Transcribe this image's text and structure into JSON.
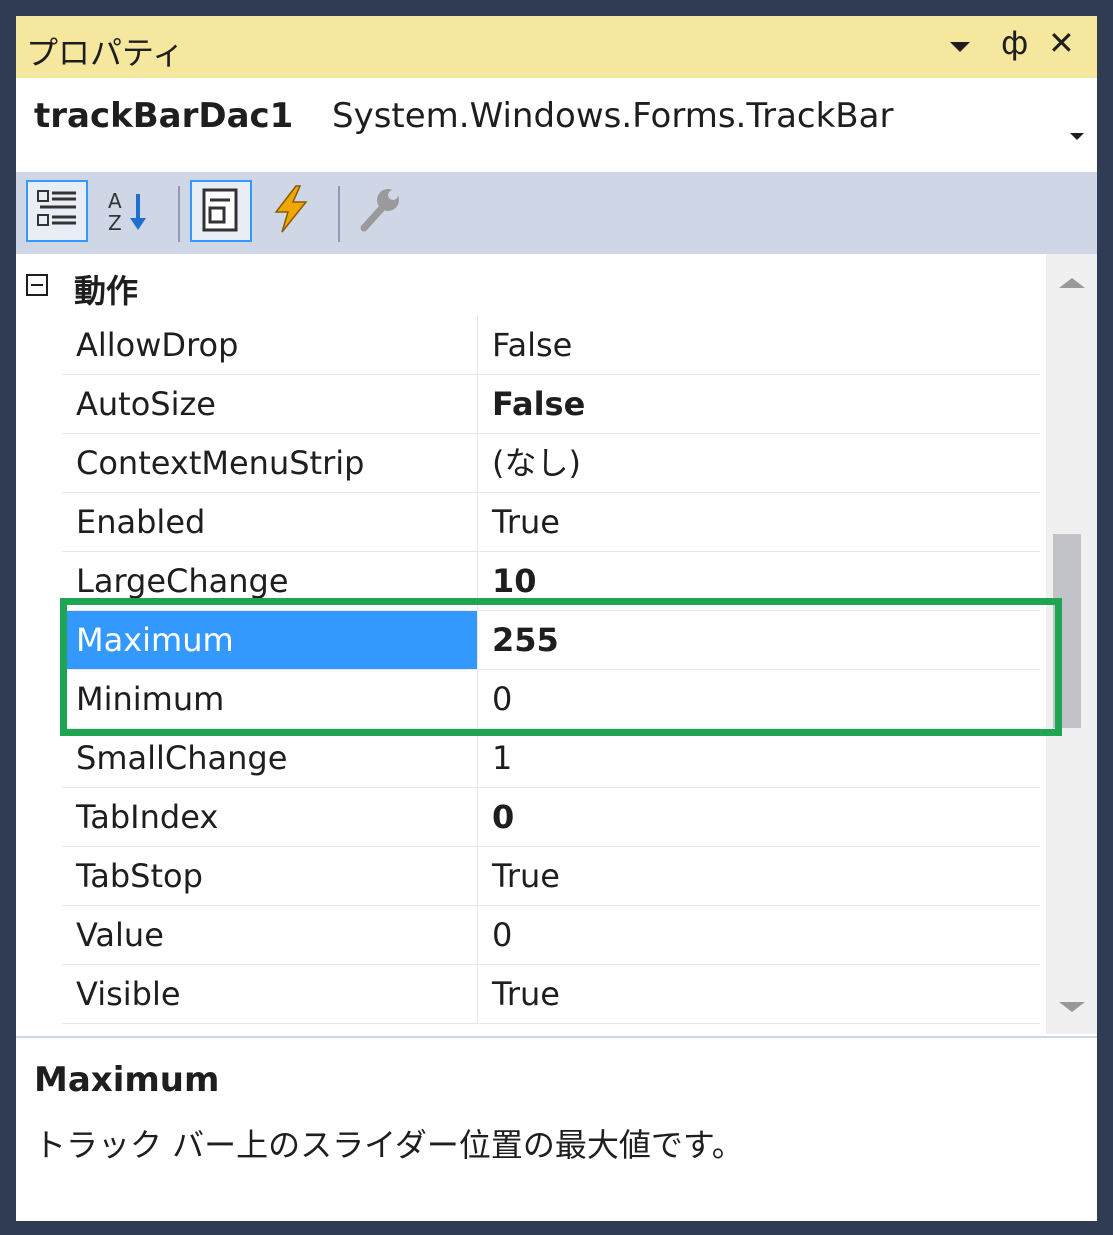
{
  "titlebar": {
    "title": "プロパティ",
    "pin_glyph": "ф",
    "close_glyph": "✕"
  },
  "object_selector": {
    "name": "trackBarDac1",
    "type": "System.Windows.Forms.TrackBar"
  },
  "toolbar": {
    "buttons": [
      {
        "icon": "categorized-icon",
        "active": true
      },
      {
        "icon": "alphabetical-sort-icon",
        "active": false
      },
      {
        "icon": "properties-page-icon",
        "active": true
      },
      {
        "icon": "events-lightning-icon",
        "active": false
      },
      {
        "icon": "property-pages-wrench-icon",
        "active": false
      }
    ]
  },
  "grid": {
    "category": "動作",
    "properties": [
      {
        "name": "AllowDrop",
        "value": "False"
      },
      {
        "name": "AutoSize",
        "value": "False"
      },
      {
        "name": "ContextMenuStrip",
        "value": "(なし)"
      },
      {
        "name": "Enabled",
        "value": "True"
      },
      {
        "name": "LargeChange",
        "value": "10"
      },
      {
        "name": "Maximum",
        "value": "255"
      },
      {
        "name": "Minimum",
        "value": "0"
      },
      {
        "name": "SmallChange",
        "value": "1"
      },
      {
        "name": "TabIndex",
        "value": "0"
      },
      {
        "name": "TabStop",
        "value": "True"
      },
      {
        "name": "Value",
        "value": "0"
      },
      {
        "name": "Visible",
        "value": "True"
      }
    ]
  },
  "description": {
    "title": "Maximum",
    "text": "トラック バー上のスライダー位置の最大値です。"
  },
  "colors": {
    "titlebar": "#f5e79e",
    "toolbar": "#cfd6e5",
    "selection": "#3399ff",
    "highlight_box": "#1fa552"
  }
}
